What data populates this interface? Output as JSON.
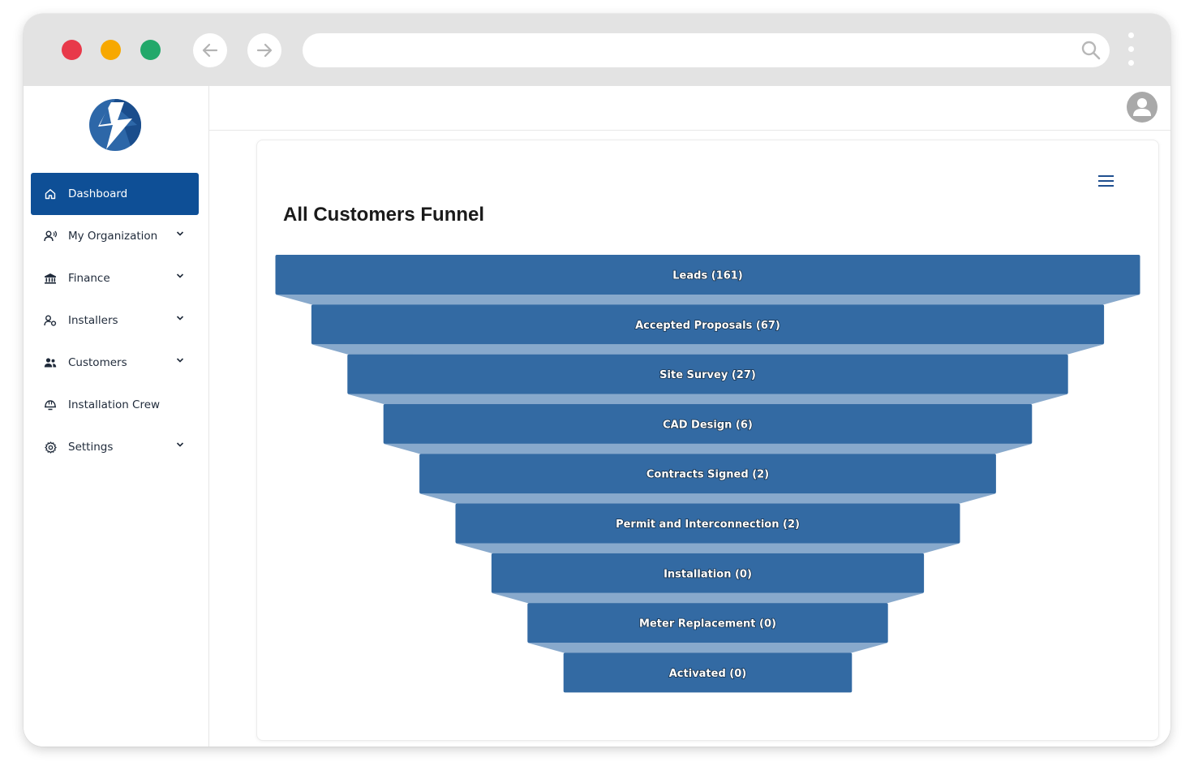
{
  "browser": {
    "traffic_lights": [
      "#e8394a",
      "#f7a800",
      "#22a86a"
    ],
    "address_value": ""
  },
  "sidebar": {
    "items": [
      {
        "label": "Dashboard",
        "icon": "home-icon",
        "active": true,
        "has_chevron": false
      },
      {
        "label": "My Organization",
        "icon": "organization-icon",
        "active": false,
        "has_chevron": true
      },
      {
        "label": "Finance",
        "icon": "bank-icon",
        "active": false,
        "has_chevron": true
      },
      {
        "label": "Installers",
        "icon": "installer-icon",
        "active": false,
        "has_chevron": true
      },
      {
        "label": "Customers",
        "icon": "customers-icon",
        "active": false,
        "has_chevron": true
      },
      {
        "label": "Installation Crew",
        "icon": "helmet-icon",
        "active": false,
        "has_chevron": false
      },
      {
        "label": "Settings",
        "icon": "gear-icon",
        "active": false,
        "has_chevron": true
      }
    ],
    "active_color": "#0e4f96"
  },
  "card": {
    "title": "All Customers Funnel"
  },
  "chart_data": {
    "type": "funnel",
    "title": "All Customers Funnel",
    "bar_color": "#336aa3",
    "connector_color": "#88a9cc",
    "stages": [
      {
        "label": "Leads (161)",
        "name": "Leads",
        "value": 161
      },
      {
        "label": "Accepted Proposals (67)",
        "name": "Accepted Proposals",
        "value": 67
      },
      {
        "label": "Site Survey (27)",
        "name": "Site Survey",
        "value": 27
      },
      {
        "label": "CAD Design (6)",
        "name": "CAD Design",
        "value": 6
      },
      {
        "label": "Contracts Signed (2)",
        "name": "Contracts Signed",
        "value": 2
      },
      {
        "label": "Permit and Interconnection (2)",
        "name": "Permit and Interconnection",
        "value": 2
      },
      {
        "label": "Installation (0)",
        "name": "Installation",
        "value": 0
      },
      {
        "label": "Meter Replacement (0)",
        "name": "Meter Replacement",
        "value": 0
      },
      {
        "label": "Activated (0)",
        "name": "Activated",
        "value": 0
      }
    ]
  }
}
